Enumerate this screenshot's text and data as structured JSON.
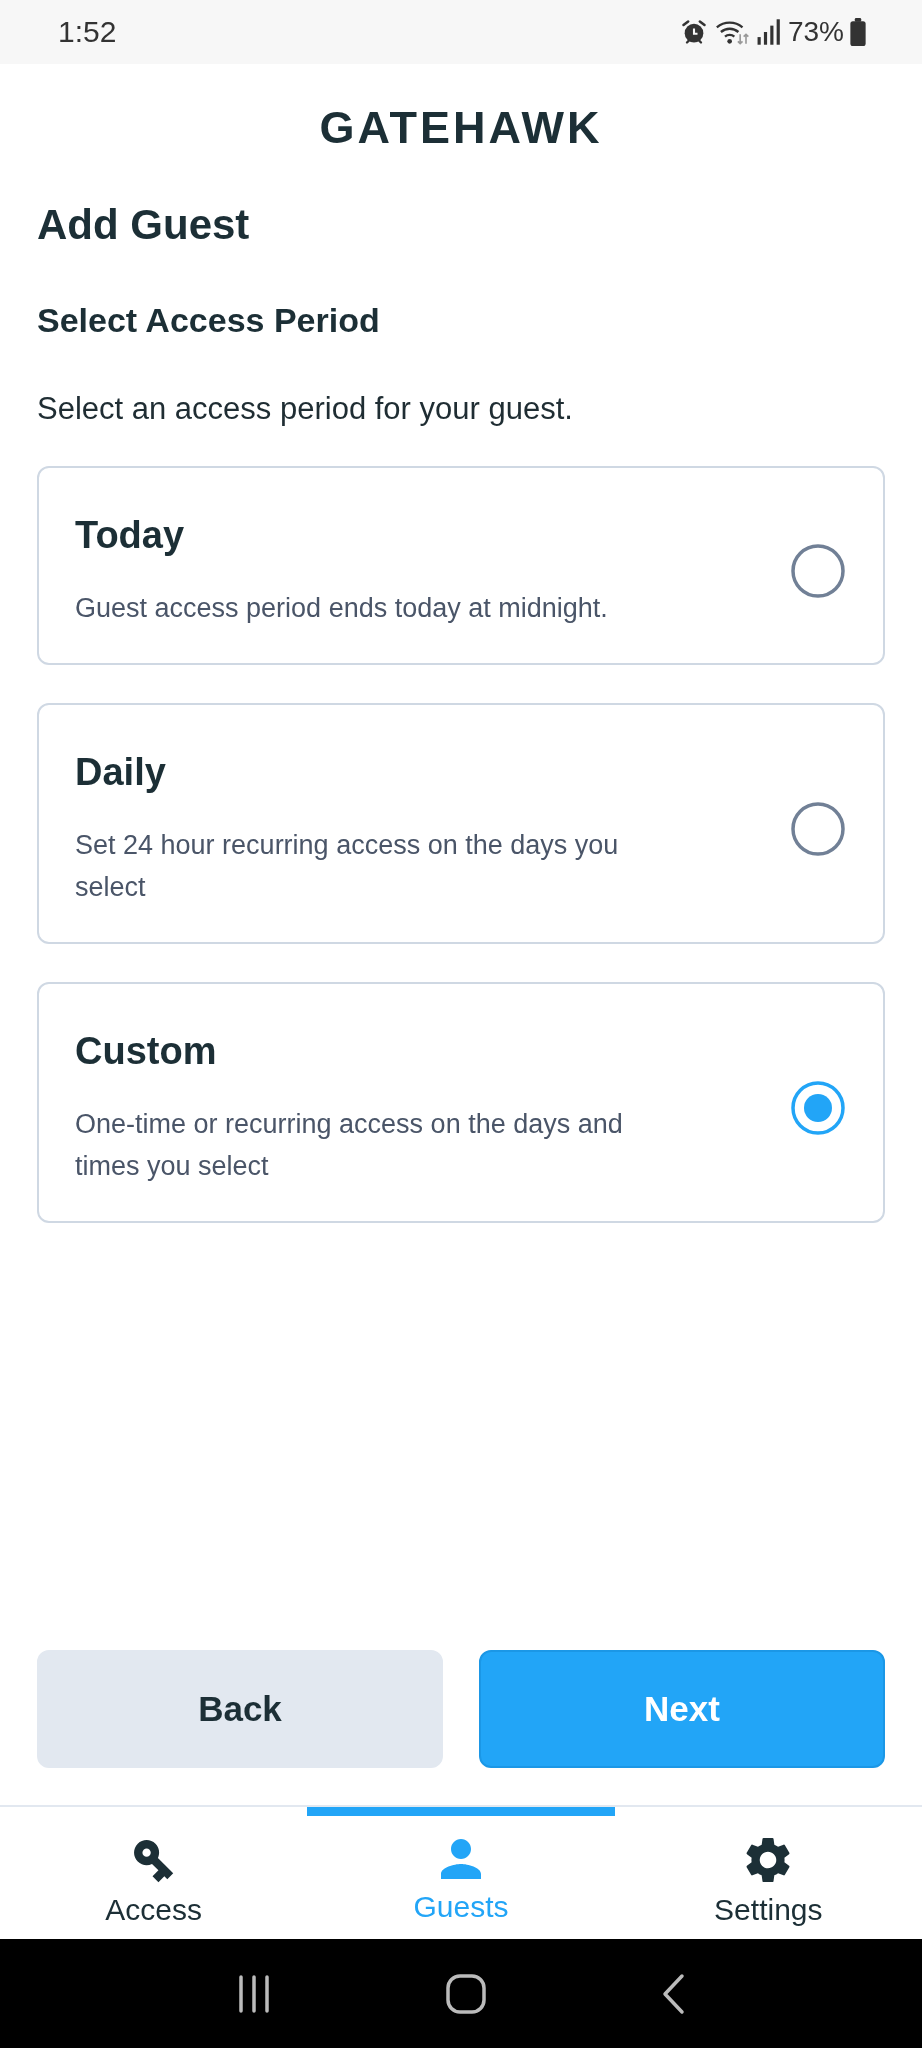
{
  "status_bar": {
    "time": "1:52",
    "battery": "73%"
  },
  "header": {
    "logo": "GATEHAWK"
  },
  "page": {
    "title": "Add Guest",
    "section_title": "Select Access Period",
    "instruction": "Select an access period for your guest."
  },
  "options": [
    {
      "title": "Today",
      "description": "Guest access period ends today at midnight.",
      "selected": false
    },
    {
      "title": "Daily",
      "description": "Set 24 hour recurring access on the days you select",
      "selected": false
    },
    {
      "title": "Custom",
      "description": "One-time or recurring access on the days and times you select",
      "selected": true
    }
  ],
  "buttons": [
    {
      "label": "Back",
      "kind": "secondary"
    },
    {
      "label": "Next",
      "kind": "primary"
    }
  ],
  "bottom_nav": [
    {
      "label": "Access",
      "selected": false
    },
    {
      "label": "Guests",
      "selected": true
    },
    {
      "label": "Settings",
      "selected": false
    }
  ]
}
